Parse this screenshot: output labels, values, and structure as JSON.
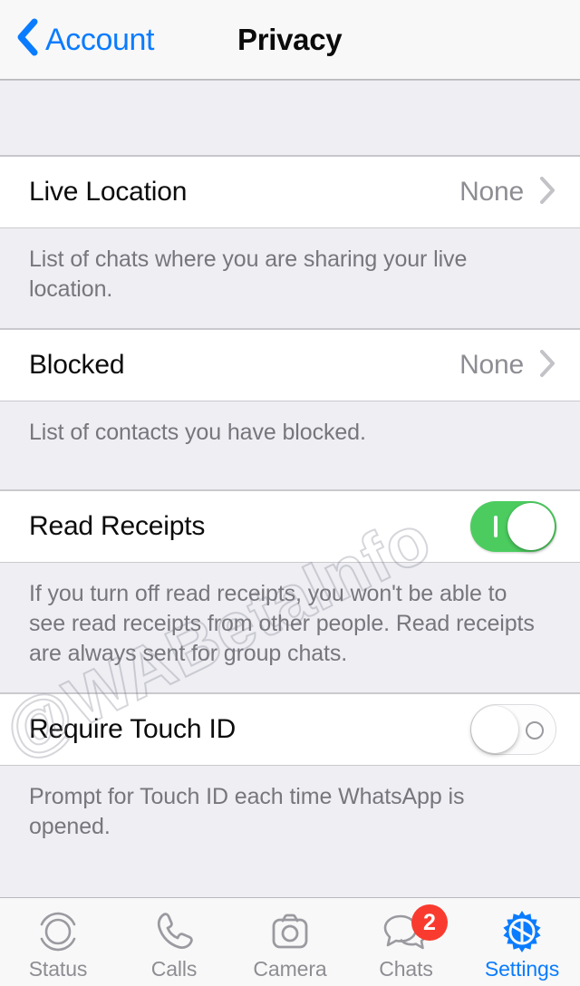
{
  "navbar": {
    "back_label": "Account",
    "title": "Privacy",
    "back_icon": "chevron-left-icon",
    "accent_color": "#0a7cff"
  },
  "sections": [
    {
      "row": {
        "title": "Live Location",
        "value": "None",
        "type": "disclosure",
        "accessory_icon": "chevron-right-icon"
      },
      "footer": "List of chats where you are sharing your live location."
    },
    {
      "row": {
        "title": "Blocked",
        "value": "None",
        "type": "disclosure",
        "accessory_icon": "chevron-right-icon"
      },
      "footer": "List of contacts you have blocked."
    },
    {
      "row": {
        "title": "Read Receipts",
        "type": "toggle",
        "toggle_state": "on",
        "toggle_color": "#4ccc5f"
      },
      "footer": "If you turn off read receipts, you won't be able to see read receipts from other people. Read receipts are always sent for group chats."
    },
    {
      "row": {
        "title": "Require Touch ID",
        "type": "toggle",
        "toggle_state": "off",
        "toggle_color": "#fdfdfd"
      },
      "footer": "Prompt for Touch ID each time WhatsApp is opened."
    }
  ],
  "watermark": {
    "text": "@WABetaInfo"
  },
  "tabbar": {
    "items": [
      {
        "label": "Status",
        "icon": "status-rings-icon",
        "active": false,
        "badge": null
      },
      {
        "label": "Calls",
        "icon": "phone-icon",
        "active": false,
        "badge": null
      },
      {
        "label": "Camera",
        "icon": "camera-icon",
        "active": false,
        "badge": null
      },
      {
        "label": "Chats",
        "icon": "chat-bubbles-icon",
        "active": false,
        "badge": "2"
      },
      {
        "label": "Settings",
        "icon": "gear-icon",
        "active": true,
        "badge": null
      }
    ],
    "active_color": "#0a7cff",
    "inactive_color": "#8d8d93",
    "badge_color": "#f93b2f"
  }
}
